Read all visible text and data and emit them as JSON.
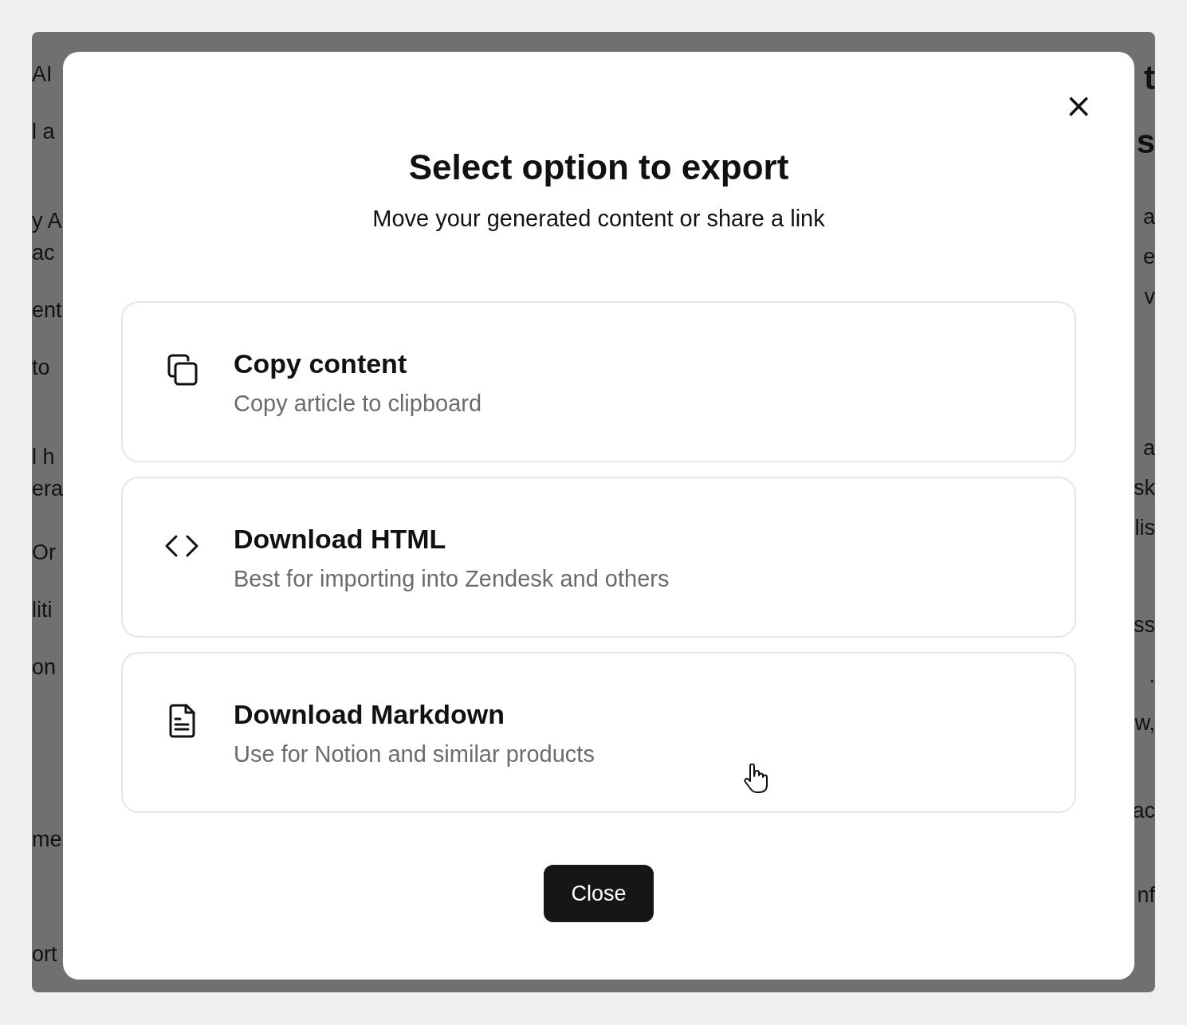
{
  "background": {
    "left_fragments": [
      "AI",
      "l a",
      "y A",
      "ac",
      "ent",
      "to",
      "l h",
      "era",
      "Or",
      "liti",
      "on",
      "me",
      "ort"
    ],
    "right_fragments": [
      "t",
      "s",
      "a",
      "e",
      "v",
      "a",
      "sk",
      "lis",
      "ss",
      ".",
      "w,",
      "ac",
      "nf"
    ]
  },
  "dialog": {
    "close_icon": "×",
    "title": "Select option to export",
    "subtitle": "Move your generated content or share a link",
    "options": [
      {
        "kind": "copy",
        "title": "Copy content",
        "description": "Copy article to clipboard"
      },
      {
        "kind": "html",
        "title": "Download HTML",
        "description": "Best for importing into Zendesk and others"
      },
      {
        "kind": "markdown",
        "title": "Download Markdown",
        "description": "Use for Notion and similar products"
      }
    ],
    "close_button": "Close"
  }
}
